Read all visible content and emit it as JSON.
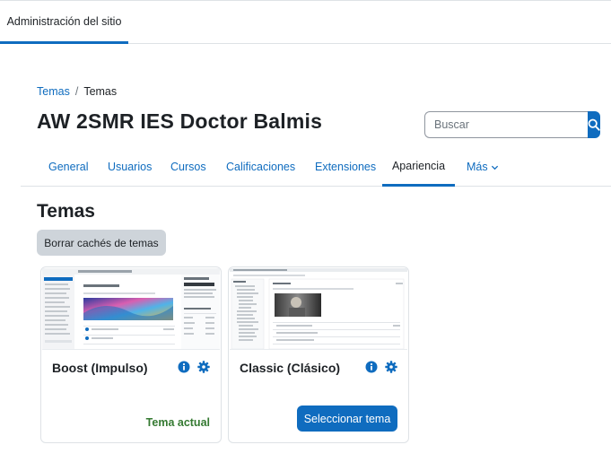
{
  "topbar": {
    "tab_label": "Administración del sitio"
  },
  "breadcrumb": {
    "items": [
      "Temas",
      "Temas"
    ],
    "separator": "/"
  },
  "site": {
    "title": "AW 2SMR IES Doctor Balmis"
  },
  "search": {
    "placeholder": "Buscar"
  },
  "nav": {
    "items": [
      "General",
      "Usuarios",
      "Cursos",
      "Calificaciones",
      "Extensiones",
      "Apariencia",
      "Más"
    ],
    "active": "Apariencia"
  },
  "page": {
    "heading": "Temas",
    "purge_label": "Borrar cachés de temas"
  },
  "themes": [
    {
      "name": "Boost (Impulso)",
      "status": "Tema actual"
    },
    {
      "name": "Classic (Clásico)",
      "action": "Seleccionar tema"
    }
  ],
  "colors": {
    "primary": "#0f6cbf",
    "success": "#357a32",
    "secondary": "#ced4da"
  }
}
